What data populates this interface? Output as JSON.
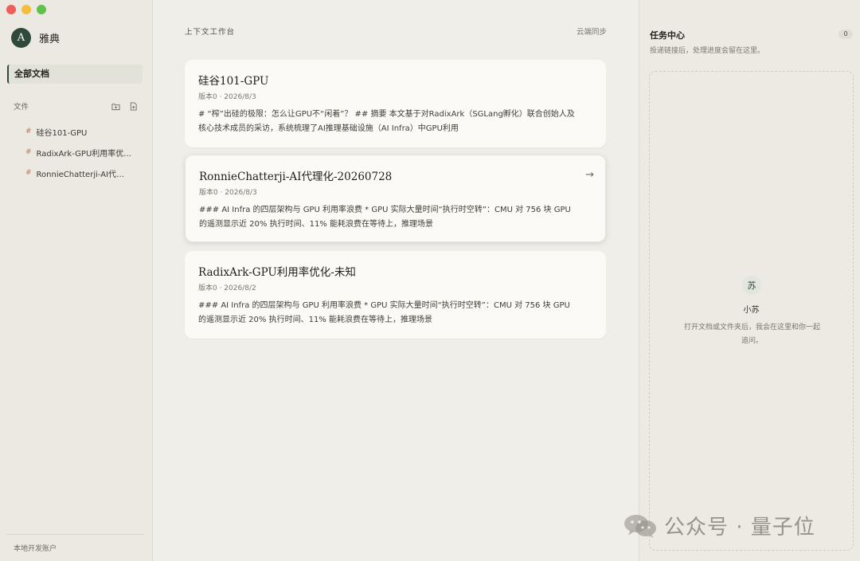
{
  "app": {
    "name": "雅典",
    "avatar_letter": "A"
  },
  "sidebar": {
    "all_docs": "全部文档",
    "files_label": "文件",
    "files": [
      {
        "hash": "#",
        "name": "硅谷101-GPU"
      },
      {
        "hash": "#",
        "name": "RadixArk-GPU利用率优..."
      },
      {
        "hash": "#",
        "name": "RonnieChatterji-AI代理..."
      }
    ],
    "account": "本地开发账户"
  },
  "main": {
    "title": "上下文工作台",
    "sync": "云端同步",
    "cards": [
      {
        "title": "硅谷101-GPU",
        "meta": "版本0 · 2026/8/3",
        "body": "# “榨”出硅的极限：怎么让GPU不“闲着”？ ## 摘要 本文基于对RadixArk（SGLang孵化）联合创始人及核心技术成员的采访，系统梳理了AI推理基础设施（AI Infra）中GPU利用"
      },
      {
        "title": "RonnieChatterji-AI代理化-20260728",
        "meta": "版本0 · 2026/8/3",
        "body": "### AI Infra 的四层架构与 GPU 利用率浪费 * GPU 实际大量时间“执行时空转”：CMU 对 756 块 GPU 的遥测显示近 20% 执行时间、11% 能耗浪费在等待上，推理场景",
        "arrow": "→"
      },
      {
        "title": "RadixArk-GPU利用率优化-未知",
        "meta": "版本0 · 2026/8/2",
        "body": "### AI Infra 的四层架构与 GPU 利用率浪费 * GPU 实际大量时间“执行时空转”：CMU 对 756 块 GPU 的遥测显示近 20% 执行时间、11% 能耗浪费在等待上，推理场景"
      }
    ]
  },
  "panel": {
    "title": "任务中心",
    "count": "0",
    "subtitle": "投递链接后，处理进度会留在这里。",
    "assistant_badge": "苏",
    "assistant_name": "小苏",
    "hint": "打开文档或文件夹后，我会在这里和你一起追问。"
  },
  "watermark": {
    "text": "公众号 · 量子位"
  }
}
